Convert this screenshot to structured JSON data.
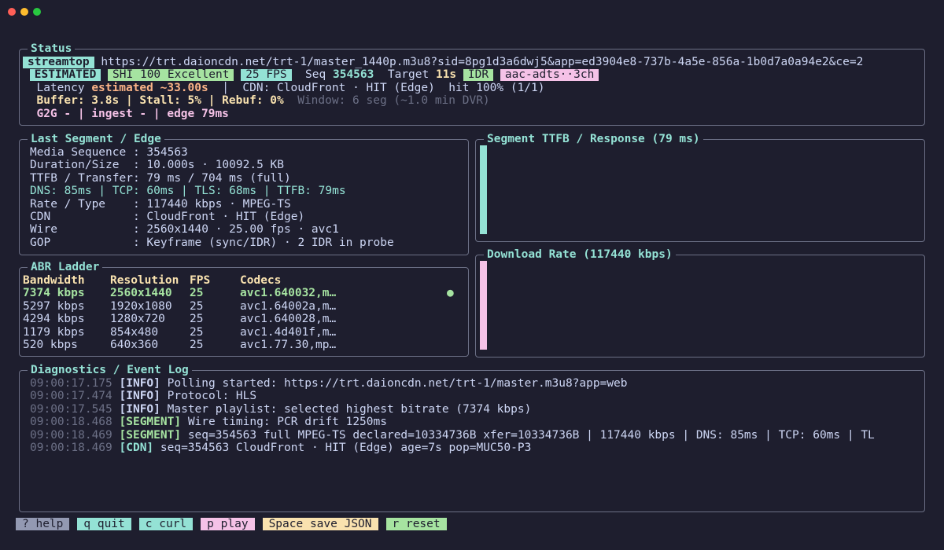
{
  "status": {
    "title": "Status",
    "app_chip": "streamtop",
    "url": "https://trt.daioncdn.net/trt-1/master_1440p.m3u8?sid=8pg1d3a6dwj5&app=ed3904e8-737b-4a5e-856a-1b0d7a0a94e2&ce=2",
    "estimated_chip": "ESTIMATED",
    "shi_chip": "SHI 100 Excellent",
    "fps_chip": "25 FPS",
    "seq_label": "Seq",
    "seq_value": "354563",
    "target_label": "Target",
    "target_value": "11s",
    "idr_chip": "IDR",
    "audio_chip": "aac-adts··3ch",
    "latency_label": "Latency",
    "latency_value": "estimated ~33.00s",
    "latency_sep": "│",
    "cdn_text": "CDN: CloudFront · HIT (Edge)  hit 100% (1/1)",
    "buffer_text": "Buffer: 3.8s | Stall: 5% | Rebuf: 0%",
    "window_text": "Window: 6 seg (~1.0 min DVR)",
    "g2g_text": "G2G - | ingest - | edge 79ms"
  },
  "segment": {
    "title": "Last Segment / Edge",
    "rows": [
      {
        "text": "Media Sequence : 354563",
        "style": "normal"
      },
      {
        "text": "Duration/Size  : 10.000s · 10092.5 KB",
        "style": "normal"
      },
      {
        "text": "TTFB / Transfer: 79 ms / 704 ms (full)",
        "style": "normal"
      },
      {
        "text": "DNS: 85ms | TCP: 60ms | TLS: 68ms | TTFB: 79ms",
        "style": "teal"
      },
      {
        "text": "Rate / Type    : 117440 kbps · MPEG-TS",
        "style": "normal"
      },
      {
        "text": "CDN            : CloudFront · HIT (Edge)",
        "style": "normal"
      },
      {
        "text": "Wire           : 2560x1440 · 25.00 fps · avc1",
        "style": "normal"
      },
      {
        "text": "GOP            : Keyframe (sync/IDR) · 2 IDR in probe",
        "style": "normal"
      }
    ]
  },
  "ttfb_panel": {
    "title": "Segment TTFB / Response (79 ms)",
    "bar_color": "#94e2d5",
    "level": 1.0
  },
  "download_panel": {
    "title": "Download Rate (117440 kbps)",
    "bar_color": "#f5c2e7",
    "level": 1.0
  },
  "abr": {
    "title": "ABR Ladder",
    "headers": [
      "Bandwidth",
      "Resolution",
      "FPS",
      "Codecs"
    ],
    "rows": [
      {
        "bandwidth": "7374 kbps",
        "resolution": "2560x1440",
        "fps": "25",
        "codecs": "avc1.640032,m…",
        "active": true,
        "indicator": "●"
      },
      {
        "bandwidth": "5297 kbps",
        "resolution": "1920x1080",
        "fps": "25",
        "codecs": "avc1.64002a,m…",
        "active": false,
        "indicator": ""
      },
      {
        "bandwidth": "4294 kbps",
        "resolution": "1280x720",
        "fps": "25",
        "codecs": "avc1.640028,m…",
        "active": false,
        "indicator": ""
      },
      {
        "bandwidth": "1179 kbps",
        "resolution": "854x480",
        "fps": "25",
        "codecs": "avc1.4d401f,m…",
        "active": false,
        "indicator": ""
      },
      {
        "bandwidth": "520 kbps",
        "resolution": "640x360",
        "fps": "25",
        "codecs": "avc1.77.30,mp…",
        "active": false,
        "indicator": ""
      }
    ]
  },
  "log": {
    "title": "Diagnostics / Event Log",
    "entries": [
      {
        "time": "09:00:17.175",
        "tag": "[INFO]",
        "tag_color": "#cdd6f4",
        "msg": "Polling started: https://trt.daioncdn.net/trt-1/master.m3u8?app=web"
      },
      {
        "time": "09:00:17.474",
        "tag": "[INFO]",
        "tag_color": "#cdd6f4",
        "msg": "Protocol: HLS"
      },
      {
        "time": "09:00:17.545",
        "tag": "[INFO]",
        "tag_color": "#cdd6f4",
        "msg": "Master playlist: selected highest bitrate (7374 kbps)"
      },
      {
        "time": "09:00:18.468",
        "tag": "[SEGMENT]",
        "tag_color": "#a6e3a1",
        "msg": "Wire timing: PCR drift 1250ms"
      },
      {
        "time": "09:00:18.469",
        "tag": "[SEGMENT]",
        "tag_color": "#a6e3a1",
        "msg": "seq=354563 full MPEG-TS declared=10334736B xfer=10334736B | 117440 kbps | DNS: 85ms | TCP: 60ms | TL"
      },
      {
        "time": "09:00:18.469",
        "tag": "[CDN]",
        "tag_color": "#94e2d5",
        "msg": "seq=354563 CloudFront · HIT (Edge) age=7s pop=MUC50-P3"
      }
    ]
  },
  "footer": [
    {
      "label": "? help",
      "color": "#9399b2",
      "name": "help-key"
    },
    {
      "label": "q quit",
      "color": "#94e2d5",
      "name": "quit-key"
    },
    {
      "label": "c curl",
      "color": "#94e2d5",
      "name": "curl-key"
    },
    {
      "label": "p play",
      "color": "#f5c2e7",
      "name": "play-key"
    },
    {
      "label": "Space save JSON",
      "color": "#f9e2af",
      "name": "save-json-key"
    },
    {
      "label": "r reset",
      "color": "#a6e3a1",
      "name": "reset-key"
    }
  ]
}
